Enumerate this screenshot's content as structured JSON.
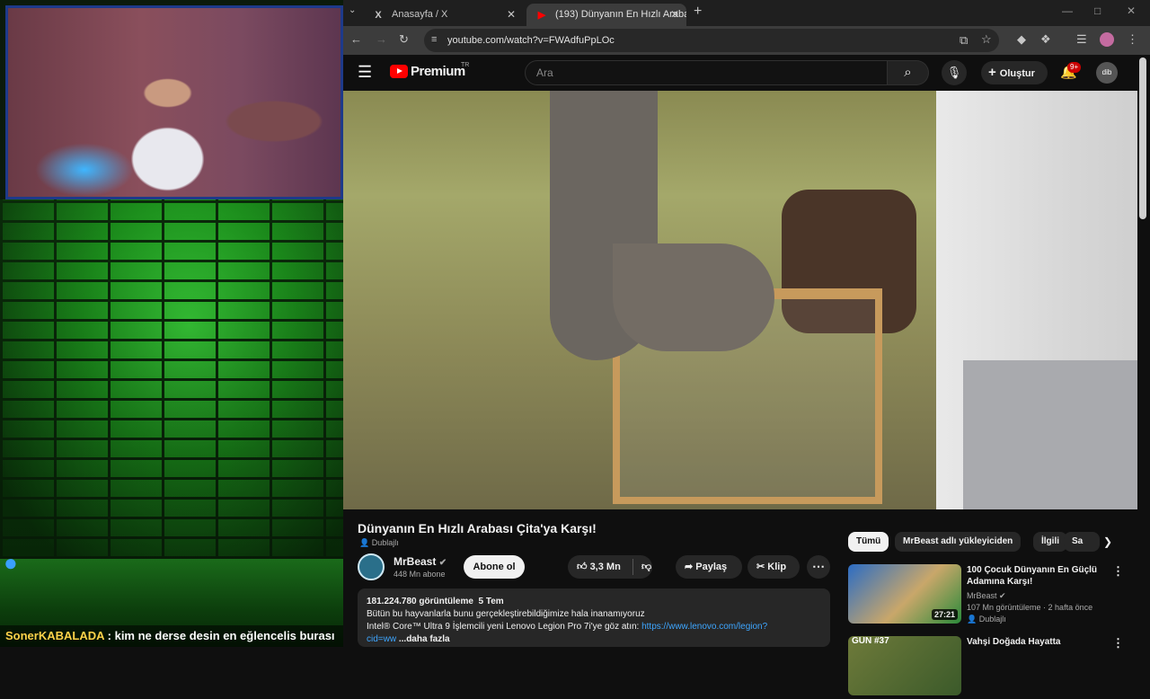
{
  "chat": {
    "user": "SonerKABALADA",
    "separator": " : ",
    "message": "kim ne derse desin en eğlencelis burası"
  },
  "browser": {
    "tabs": [
      {
        "label": "Anasayfa / X",
        "icon": "x-logo-icon"
      },
      {
        "label": "(193) Dünyanın En Hızlı Araba",
        "icon": "youtube-icon"
      }
    ],
    "url": "youtube.com/watch?v=FWAdfuPpLOc"
  },
  "youtube": {
    "logo_text": "Premium",
    "region": "TR",
    "search_placeholder": "Ara",
    "create_label": "Oluştur",
    "notifications_badge": "9+",
    "avatar_text": "dib"
  },
  "video": {
    "title": "Dünyanın En Hızlı Arabası Çita'ya Karşı!",
    "dubbed": "Dublajlı",
    "channel": "MrBeast",
    "subscribers": "448 Mn abone",
    "subscribe_label": "Abone ol",
    "likes": "3,3 Mn",
    "share_label": "Paylaş",
    "clip_label": "Klip",
    "views": "181.224.780 görüntüleme",
    "date": "5 Tem",
    "desc_line1": "Bütün bu hayvanlarla bunu gerçekleştirebildiğimize hala inanamıyoruz",
    "desc_line2": "Intel® Core™ Ultra 9 İşlemcili yeni Lenovo Legion Pro 7i'ye göz atın: ",
    "desc_link": "https://www.lenovo.com/legion?",
    "desc_link2": "cid=ww",
    "desc_more": "...daha fazla"
  },
  "chips": [
    "Tümü",
    "MrBeast adlı yükleyiciden",
    "İlgili",
    "Sa"
  ],
  "recommendations": [
    {
      "title": "100 Çocuk Dünyanın En Güçlü Adamına Karşı!",
      "channel": "MrBeast",
      "meta": "107 Mn görüntüleme · 2 hafta önce",
      "dubbed": "Dublajlı",
      "duration": "27:21"
    },
    {
      "title": "Vahşi Doğada Hayatta",
      "thumb_text": "GÜN #37"
    }
  ]
}
